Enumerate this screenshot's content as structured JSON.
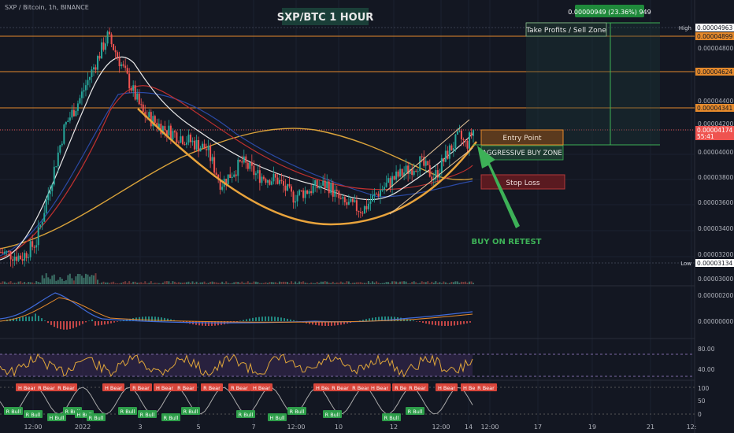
{
  "header": {
    "symbol_line": "SXP / Bitcoin, 1h, BINANCE",
    "title": "SXP/BTC 1 HOUR"
  },
  "colors": {
    "background": "#131722",
    "grid": "#1f2433",
    "price_up": "#26a69a",
    "price_down": "#ef5350",
    "orange_level": "#e58a2c",
    "bowl_curve": "#e8a33c",
    "ema_fast": "#e8e8e8",
    "ema_mid": "#c0302f",
    "ema_slow": "#2b4aa6",
    "ema_long": "#d9a23a",
    "green_arrow": "#3db157",
    "stop_box": "#7a1f27",
    "entry_box": "#5b3a1e"
  },
  "annotations": {
    "take_profit_label": "Take Profits / Sell Zone",
    "entry_label": "Entry Point",
    "aggressive_label": "AGGRESSIVE BUY ZONE",
    "stop_label": "Stop Loss",
    "buy_retest_label": "BUY ON RETEST",
    "measure_label": "0.00000949 (23.36%) 949"
  },
  "price_axis": {
    "high_tag": "High",
    "high_value": "0.00004963",
    "low_tag": "Low",
    "low_value": "0.00003134",
    "current_value": "0.00004174",
    "countdown": "55:41",
    "levels": [
      "0.00004899",
      "0.00004624",
      "0.00004341"
    ],
    "ticks": [
      "0.00004800",
      "0.00004400",
      "0.00004200",
      "0.00004000",
      "0.00003800",
      "0.00003600",
      "0.00003400",
      "0.00003200",
      "0.00003000"
    ]
  },
  "macd_axis": {
    "ticks": [
      "0.00000200",
      "0.00000000"
    ]
  },
  "rsi_axis": {
    "ticks": [
      "80.00",
      "40.00"
    ]
  },
  "stoch_axis": {
    "ticks": [
      "100",
      "50",
      "0"
    ]
  },
  "time_axis": {
    "ticks": [
      "12:00",
      "2022",
      "3",
      "5",
      "7",
      "12:00",
      "10",
      "12",
      "12:00",
      "14",
      "12:00",
      "17",
      "19",
      "21",
      "12:"
    ]
  },
  "divergence_labels": {
    "bear": [
      "H Bear",
      "R Bear",
      "R Bear",
      "H Bear",
      "R Bear",
      "H Bear",
      "R Bear",
      "R Bear",
      "R Bear",
      "H Bear",
      "H Bear",
      "R Bear",
      "R Bear",
      "H Bear",
      "R Bear",
      "R Bear",
      "H Bear",
      "H Bear",
      "R Bear"
    ],
    "bull": [
      "R Bull",
      "R Bull",
      "H Bull",
      "R Bull",
      "H Bull",
      "R Bull",
      "R Bull",
      "R Bull",
      "R Bull",
      "R Bull",
      "R Bull",
      "H Bull",
      "R Bull",
      "R Bull",
      "R Bull",
      "R Bull"
    ]
  },
  "chart_data": {
    "type": "candlestick",
    "title": "SXP/BTC 1 HOUR",
    "symbol": "SXP / Bitcoin, 1h, BINANCE",
    "ylim": [
      3e-05,
      5e-05
    ],
    "horizontal_levels": [
      4.899e-05,
      4.624e-05,
      4.341e-05
    ],
    "high": 4.963e-05,
    "low": 3.134e-05,
    "last": 4.174e-05,
    "x_ticks": [
      "12:00",
      "2022",
      "3",
      "5",
      "7",
      "12:00",
      "10",
      "12",
      "12:00",
      "14",
      "12:00",
      "17",
      "19",
      "21"
    ],
    "price_path": [
      [
        0.0,
        3.22e-05
      ],
      [
        0.03,
        3.18e-05
      ],
      [
        0.05,
        3.3e-05
      ],
      [
        0.07,
        3.75e-05
      ],
      [
        0.09,
        4.2e-05
      ],
      [
        0.11,
        4.4e-05
      ],
      [
        0.13,
        4.65e-05
      ],
      [
        0.15,
        4.9e-05
      ],
      [
        0.16,
        4.8e-05
      ],
      [
        0.18,
        4.55e-05
      ],
      [
        0.2,
        4.3e-05
      ],
      [
        0.23,
        4.18e-05
      ],
      [
        0.26,
        4.1e-05
      ],
      [
        0.29,
        4.02e-05
      ],
      [
        0.31,
        3.75e-05
      ],
      [
        0.34,
        3.92e-05
      ],
      [
        0.36,
        3.82e-05
      ],
      [
        0.39,
        3.78e-05
      ],
      [
        0.41,
        3.65e-05
      ],
      [
        0.44,
        3.72e-05
      ],
      [
        0.46,
        3.75e-05
      ],
      [
        0.48,
        3.6e-05
      ],
      [
        0.51,
        3.55e-05
      ],
      [
        0.53,
        3.68e-05
      ],
      [
        0.55,
        3.78e-05
      ],
      [
        0.57,
        3.85e-05
      ],
      [
        0.59,
        3.92e-05
      ],
      [
        0.61,
        3.8e-05
      ],
      [
        0.63,
        4e-05
      ],
      [
        0.645,
        4.12e-05
      ],
      [
        0.655,
        4.05e-05
      ],
      [
        0.665,
        4.17e-05
      ]
    ],
    "entry_price": 4.17e-05,
    "stop_price": 3.79e-05,
    "take_profit_price": 4.96e-05
  }
}
